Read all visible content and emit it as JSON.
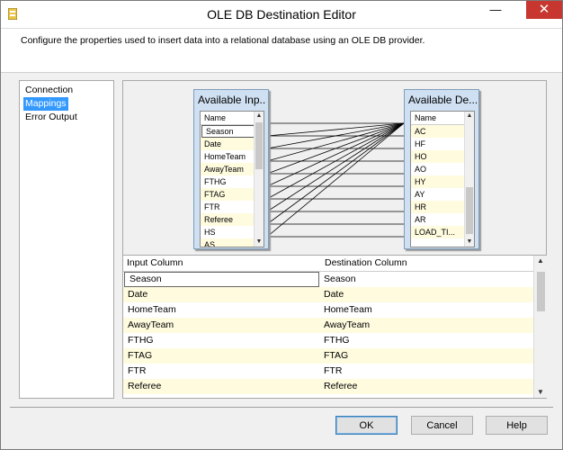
{
  "window": {
    "title": "OLE DB Destination Editor",
    "minimize_glyph": "—",
    "close_glyph": "✕",
    "icon": "ssis-component-icon"
  },
  "description": "Configure the properties used to insert data into a relational database using an OLE DB provider.",
  "nav": {
    "items": [
      "Connection Manager",
      "Mappings",
      "Error Output"
    ],
    "selected": "Mappings"
  },
  "source_table": {
    "title": "Available Inp...",
    "column_header": "Name",
    "columns": [
      "Season",
      "Date",
      "HomeTeam",
      "AwayTeam",
      "FTHG",
      "FTAG",
      "FTR",
      "Referee",
      "HS",
      "AS"
    ]
  },
  "dest_table": {
    "title": "Available De...",
    "column_header": "Name",
    "columns": [
      "AC",
      "HF",
      "HO",
      "AO",
      "HY",
      "AY",
      "HR",
      "AR",
      "LOAD_TI..."
    ]
  },
  "grid": {
    "headers": [
      "Input Column",
      "Destination Column"
    ],
    "rows": [
      [
        "Season",
        "Season"
      ],
      [
        "Date",
        "Date"
      ],
      [
        "HomeTeam",
        "HomeTeam"
      ],
      [
        "AwayTeam",
        "AwayTeam"
      ],
      [
        "FTHG",
        "FTHG"
      ],
      [
        "FTAG",
        "FTAG"
      ],
      [
        "FTR",
        "FTR"
      ],
      [
        "Referee",
        "Referee"
      ]
    ]
  },
  "buttons": {
    "ok": "OK",
    "cancel": "Cancel",
    "help": "Help"
  },
  "colors": {
    "selection": "#3399ff",
    "alt_row": "#fffbdf",
    "table_header": "#cfe0f2",
    "close": "#c7372f"
  }
}
